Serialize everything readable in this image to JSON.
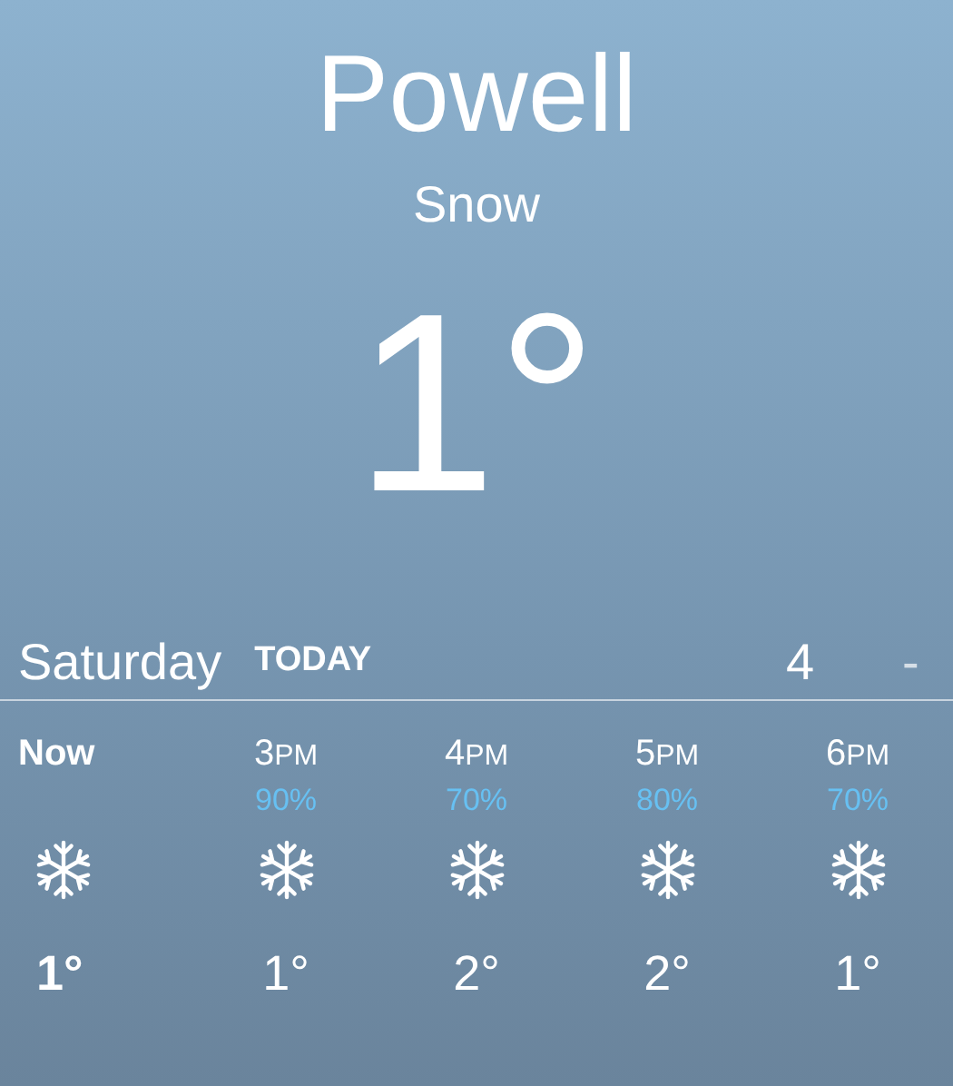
{
  "location": {
    "city": "Powell",
    "condition": "Snow",
    "temperature": "1°"
  },
  "today": {
    "day": "Saturday",
    "badge": "TODAY",
    "high": "4",
    "low": "-"
  },
  "hourly": [
    {
      "hour": "Now",
      "current": true,
      "temp": "1°"
    },
    {
      "hour": "3",
      "meridiem": "PM",
      "current": false,
      "precip": "90%",
      "temp": "1°"
    },
    {
      "hour": "4",
      "meridiem": "PM",
      "current": false,
      "precip": "70%",
      "temp": "2°"
    },
    {
      "hour": "5",
      "meridiem": "PM",
      "current": false,
      "precip": "80%",
      "temp": "2°"
    },
    {
      "hour": "6",
      "meridiem": "PM",
      "current": false,
      "precip": "70%",
      "temp": "1°"
    }
  ]
}
